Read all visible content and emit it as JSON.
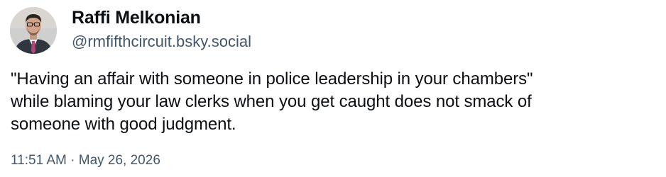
{
  "post": {
    "author": {
      "display_name": "Raffi Melkonian",
      "handle": "@rmfifthcircuit.bsky.social",
      "avatar_icon": "avatar-photo"
    },
    "text_lines": [
      "\"Having an affair with someone in police leadership in your chambers\"",
      "while blaming your law clerks when you get caught does not smack of",
      "someone with good judgment."
    ],
    "timestamp": "11:51 AM · May 26, 2026"
  },
  "colors": {
    "text_primary": "#0b0f14",
    "text_secondary": "#42576c",
    "background": "#ffffff"
  }
}
